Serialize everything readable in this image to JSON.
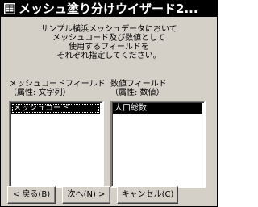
{
  "window": {
    "title": "メッシュ塗り分けウイザード2..."
  },
  "description": {
    "lines": [
      "サンプル横浜メッシュデータにおいて",
      "メッシュコード及び数値として",
      "使用するフィールドを",
      "それぞれ指定してください。"
    ]
  },
  "mesh_field": {
    "label": "メッシュコードフィールド",
    "attribute": "（属性: 文字列）",
    "items": [
      "メッシュコード"
    ]
  },
  "value_field": {
    "label": "数値フィールド",
    "attribute": "（属性: 数値）",
    "items": [
      "人口総数"
    ]
  },
  "buttons": {
    "back": "< 戻る(B)",
    "next": "次へ(N) >",
    "cancel": "キャンセル(C)"
  },
  "icons": {
    "title": "wizard-window-icon"
  },
  "colors": {
    "dialog_face": "#d4d0c8",
    "titlebar": "#000000",
    "selection": "#000000",
    "list_background": "#ffffff"
  }
}
